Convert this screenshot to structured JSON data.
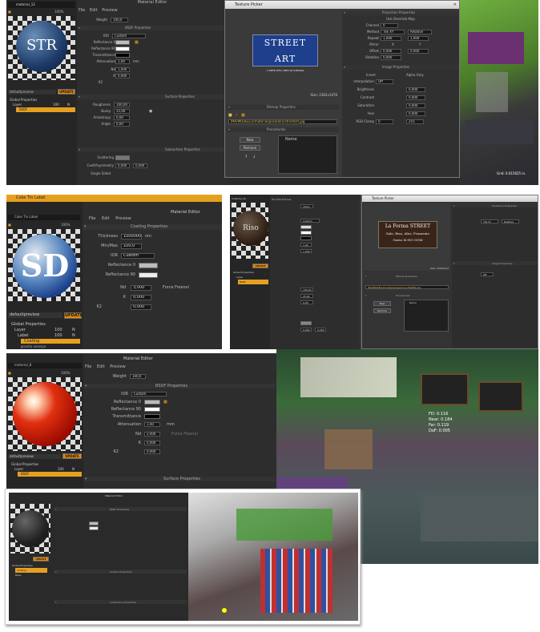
{
  "shot1": {
    "material_name": "material_12",
    "zoom": "100%",
    "menu": [
      "File",
      "Edit",
      "Preview"
    ],
    "header": "Material Editor",
    "weight_label": "Weight",
    "weight_value": "100,0",
    "bsdf_title": "BSDF Properties",
    "ior_label": "IOR",
    "ior_value": "Custom",
    "reflectance0": "Reflectance 0",
    "reflectance90": "Reflectance 90",
    "transmittance": "Transmittance",
    "attenuation_label": "Attenuation",
    "attenuation_value": "1,00",
    "attenuation_unit": "mm",
    "nd_label": "Nd",
    "nd_value": "1,000",
    "k_label": "K",
    "k_value": "0,000",
    "k2_label": "K2",
    "surface_title": "Surface Properties",
    "roughness_label": "Roughness",
    "roughness_value": "100,00",
    "bump_label": "Bump",
    "bump_value": "25,00",
    "anisotropy_label": "Anisotropy",
    "anisotropy_value": "0,00",
    "angle_label": "Angle",
    "angle_value": "0,00",
    "subsurface_title": "Subsurface Properties",
    "scattering_label": "Scattering",
    "coef_label": "Coef/Asymmetry",
    "coef_a": "0,000",
    "coef_b": "0,000",
    "single_sided": "Single Sided",
    "preview_select": "defaultpreview",
    "update": "UPDATE",
    "tree": [
      "Global Properties",
      "Layer",
      "BSDF"
    ],
    "tree_values": [
      "100",
      "N"
    ],
    "grid_label": "Grid: 0.015625 in."
  },
  "tp1": {
    "title": "Texture Picker",
    "proj_title": "Projection Properties",
    "use_override": "Use Override Map",
    "channel_label": "Channel",
    "channel_value": "0",
    "method_label": "Method",
    "method_value": "Tile XY",
    "method_b": "Relative",
    "repeat_label": "Repeat",
    "repeat_a": "1,000",
    "repeat_b": "1,000",
    "mirror_label": "Mirror",
    "mirror_a": "X",
    "mirror_b": "Y",
    "offset_label": "Offset",
    "offset_a": "0,000",
    "offset_b": "0,000",
    "rotation_label": "Rotation",
    "rotation_value": "0,000",
    "image_title": "Image Properties",
    "invert": "Invert",
    "alpha_only": "Alpha Only",
    "interp_label": "Interpolation",
    "interp_value": "Off",
    "brightness_label": "Brightness",
    "brightness_value": "0,000",
    "contrast_label": "Contrast",
    "contrast_value": "0,000",
    "saturation_label": "Saturation",
    "saturation_value": "0,000",
    "hue_label": "Hue",
    "hue_value": "0,000",
    "rgb_clamp_label": "RGB Clamp",
    "rgb_a": "0",
    "rgb_b": "255",
    "size": "Size: 2362x1476",
    "bitmap_title": "Bitmap Properties",
    "path": "IMA/MODELLO/material/pesodoro/streetart.jpg",
    "procedurals_title": "Procedurals",
    "new": "New",
    "remove": "Remove",
    "name_col": "Name",
    "sign_big": "STREET ART",
    "sign_small": "L'ARTE DEL CIBO DI STRADA"
  },
  "coke": {
    "title": "Coke Tin Label",
    "name": "Coke Tin Label",
    "zoom": "100%",
    "menu": [
      "File",
      "Edit",
      "Preview"
    ],
    "header": "Material Editor",
    "coating_title": "Coating Properties",
    "thickness_label": "Thickness",
    "thickness_value": "1000000",
    "thickness_unit": "nm",
    "minmax_label": "Min/Max",
    "minmax_value": "100,0",
    "ior_label": "IOR",
    "ior_value": "Custom",
    "reflectance0": "Reflectance 0",
    "reflectance90": "Reflectance 90",
    "nd_label": "Nd",
    "nd_value": "3,000",
    "force_fresnel": "Force Fresnel",
    "k_label": "K",
    "k_value": "0,000",
    "k2_label": "K2",
    "k2_value": "0,000",
    "preview_select": "defaultpreview",
    "update": "UPDATE",
    "tree": [
      "Global Properties",
      "Layer",
      "Label",
      "Coating"
    ],
    "tree_values": [
      "100",
      "N"
    ],
    "extra": "granito sarespe"
  },
  "shot3": {
    "material_name": "material_16",
    "header": "Material Editor",
    "menu": [
      "File",
      "Edit",
      "Preview"
    ],
    "weight_value": "100,0",
    "ior_value": "Custom",
    "attenuation_value": "1,00",
    "nd_value": "1,000",
    "roughness_value": "100,00",
    "bump_value": "25,00",
    "anisotropy_value": "0,00",
    "coef_a": "0,000",
    "coef_b": "0,000",
    "update": "UPDATE",
    "tree": [
      "Global Properties",
      "Layer",
      "BSDF"
    ]
  },
  "tp2": {
    "title": "Texture Picker",
    "proj_title": "Projection Properties",
    "image_title": "Image Properties",
    "bitmap_title": "Bitmap Properties",
    "procedurals_title": "Procedurals",
    "method_value": "Tile XY",
    "method_b": "Relative",
    "interp_value": "Off",
    "path": "IMA/MODELLO/material/pesodoro/SOPRA.jpg",
    "size": "Size: 1259x512",
    "new": "New",
    "remove": "Remove",
    "name_col": "Name",
    "sign": [
      "La Forma STREET",
      "Sale, Riso, Alici, Frumento",
      "Gusto Si-NO OGM"
    ]
  },
  "shot5": {
    "material_name": "material_8",
    "zoom": "100%",
    "menu": [
      "File",
      "Edit",
      "Preview"
    ],
    "header": "Material Editor",
    "weight_label": "Weight",
    "weight_value": "100,0",
    "bsdf_title": "BSDF Properties",
    "ior_label": "IOR",
    "ior_value": "Custom",
    "reflectance0": "Reflectance 0",
    "reflectance90": "Reflectance 90",
    "transmittance": "Transmittance",
    "attenuation_label": "Attenuation",
    "attenuation_value": "1,00",
    "attenuation_unit": "mm",
    "nd_label": "Nd",
    "nd_value": "2,000",
    "force_fresnel": "Force Fresnel",
    "k_label": "K",
    "k_value": "0,000",
    "k2_label": "K2",
    "k2_value": "0,000",
    "surface_title": "Surface Properties",
    "preview_select": "defaultpreview",
    "update": "UPDATE",
    "tree": [
      "Global Properties",
      "Layer",
      "BSDF"
    ],
    "tree_values": [
      "100",
      "N"
    ],
    "overlay": [
      "FD: 0.116",
      "Near: 0.184",
      "Far: 0.119",
      "DoF: 0.005"
    ]
  },
  "shot6": {
    "header": "Material Editor",
    "bsdf_title": "BSDF Properties",
    "surface_title": "Surface Properties",
    "subsurface_title": "Subsurface Properties",
    "update": "UPDATE",
    "tree": [
      "Global Properties",
      "Coating",
      "Base"
    ]
  }
}
